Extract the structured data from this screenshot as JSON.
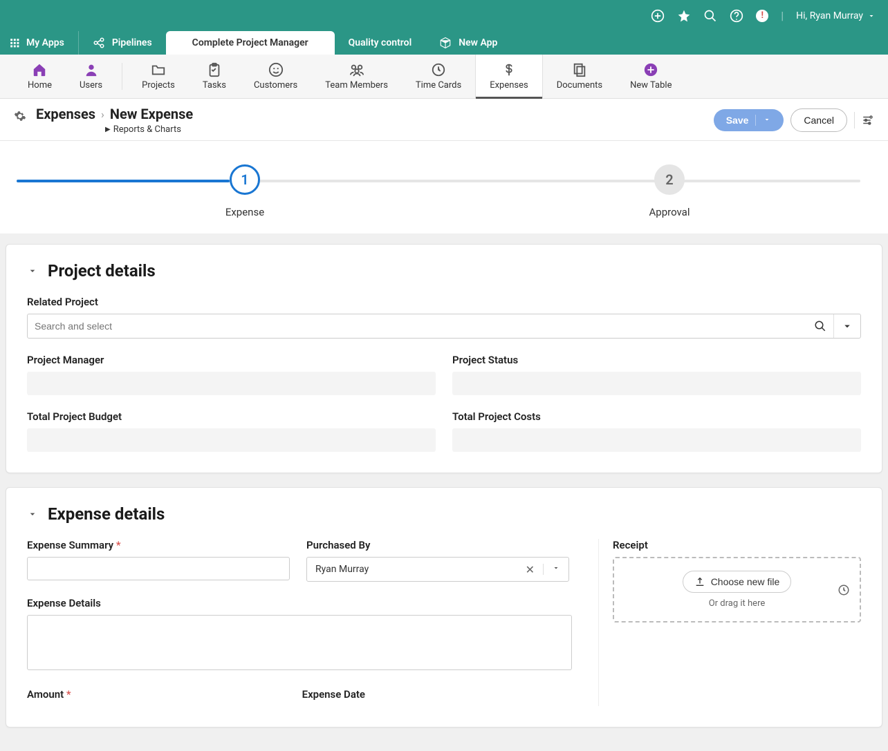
{
  "header": {
    "greeting": "Hi, Ryan Murray"
  },
  "apptabs": {
    "myapps": "My Apps",
    "pipelines": "Pipelines",
    "cpm": "Complete Project Manager",
    "qc": "Quality control",
    "newapp": "New App"
  },
  "nav": {
    "home": "Home",
    "users": "Users",
    "projects": "Projects",
    "tasks": "Tasks",
    "customers": "Customers",
    "team": "Team Members",
    "timecards": "Time Cards",
    "expenses": "Expenses",
    "documents": "Documents",
    "newtable": "New Table"
  },
  "breadcrumb": {
    "parent": "Expenses",
    "current": "New Expense",
    "sub": "Reports & Charts"
  },
  "actions": {
    "save": "Save",
    "cancel": "Cancel"
  },
  "steps": {
    "s1num": "1",
    "s1label": "Expense",
    "s2num": "2",
    "s2label": "Approval"
  },
  "projectDetails": {
    "title": "Project details",
    "relatedLabel": "Related Project",
    "relatedPlaceholder": "Search and select",
    "pmLabel": "Project Manager",
    "statusLabel": "Project Status",
    "budgetLabel": "Total Project Budget",
    "costsLabel": "Total Project Costs"
  },
  "expenseDetails": {
    "title": "Expense details",
    "summaryLabel": "Expense Summary",
    "purchasedByLabel": "Purchased By",
    "purchasedByValue": "Ryan Murray",
    "detailsLabel": "Expense Details",
    "amountLabel": "Amount",
    "dateLabel": "Expense Date",
    "receiptLabel": "Receipt",
    "chooseFile": "Choose new file",
    "dragHint": "Or drag it here"
  }
}
